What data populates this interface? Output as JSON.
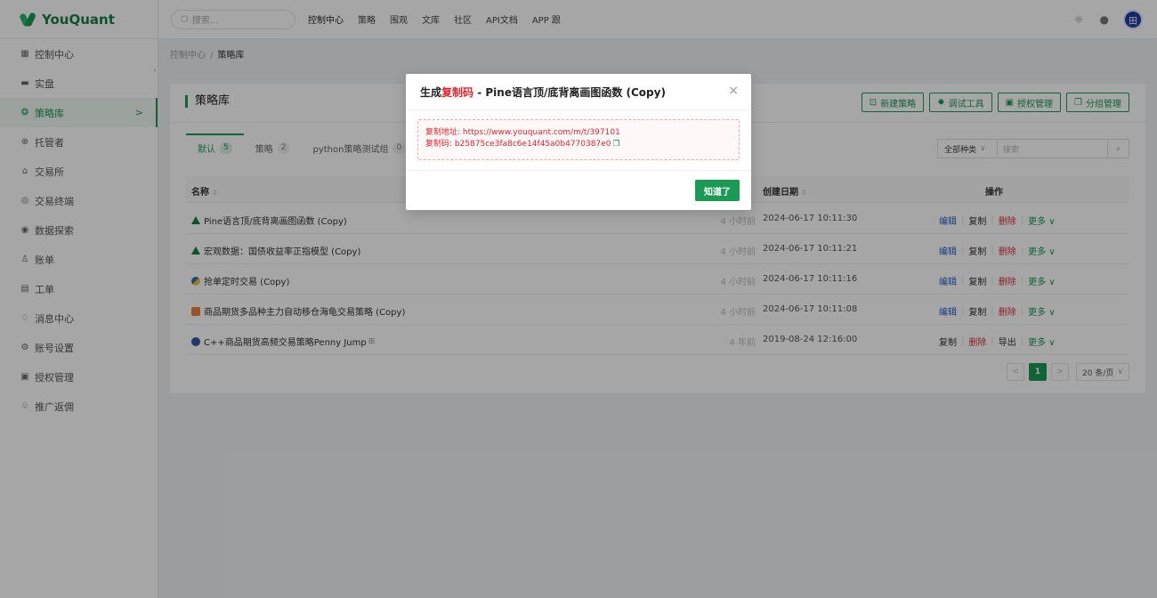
{
  "app": {
    "brand": "YouQuant"
  },
  "sidebar": {
    "items": [
      {
        "label": "控制中心",
        "icon": "dashboard-icon",
        "glyph": "▦"
      },
      {
        "label": "实盘",
        "icon": "live-icon",
        "glyph": "▬"
      },
      {
        "label": "策略库",
        "icon": "strategy-icon",
        "glyph": "❂"
      },
      {
        "label": "托管者",
        "icon": "docker-icon",
        "glyph": "⊕"
      },
      {
        "label": "交易所",
        "icon": "exchange-icon",
        "glyph": "⌂"
      },
      {
        "label": "交易终端",
        "icon": "terminal-icon",
        "glyph": "◎"
      },
      {
        "label": "数据探索",
        "icon": "data-icon",
        "glyph": "◉"
      },
      {
        "label": "账单",
        "icon": "bill-icon",
        "glyph": "♙"
      },
      {
        "label": "工单",
        "icon": "ticket-icon",
        "glyph": "▤"
      },
      {
        "label": "消息中心",
        "icon": "bell-icon",
        "glyph": "♢"
      },
      {
        "label": "账号设置",
        "icon": "gear-icon",
        "glyph": "⚙"
      },
      {
        "label": "授权管理",
        "icon": "auth-icon",
        "glyph": "▣"
      },
      {
        "label": "推广返佣",
        "icon": "promote-icon",
        "glyph": "♧"
      }
    ],
    "active_arrow": ">"
  },
  "topbar": {
    "search_placeholder": "搜索...",
    "nav": [
      "控制中心",
      "策略",
      "围观",
      "文库",
      "社区",
      "API文档",
      "APP 跟"
    ],
    "avatar_text": "田"
  },
  "breadcrumb": {
    "root": "控制中心",
    "sep": "/",
    "current": "策略库"
  },
  "card": {
    "title": "策略库",
    "actions": [
      {
        "label": "新建策略",
        "icon": "new-file-icon",
        "glyph": "⊡"
      },
      {
        "label": "调试工具",
        "icon": "debug-icon",
        "glyph": "✹"
      },
      {
        "label": "授权管理",
        "icon": "auth-icon",
        "glyph": "▣"
      },
      {
        "label": "分组管理",
        "icon": "group-icon",
        "glyph": "❐"
      }
    ],
    "tabs": [
      {
        "label": "默认",
        "count": "5"
      },
      {
        "label": "策略",
        "count": "2"
      },
      {
        "label": "python策略测试组",
        "count": "0"
      }
    ],
    "filter": {
      "type_value": "全部种类",
      "search_placeholder": "搜索"
    }
  },
  "table": {
    "headers": {
      "name": "名称",
      "date": "创建日期",
      "ops": "操作",
      "sort_glyph": "⇕"
    },
    "rows": [
      {
        "lang": "tri",
        "name": "Pine语言顶/底背离画图函数 (Copy)",
        "rel": "4 小时前",
        "date": "2024-06-17 10:11:30"
      },
      {
        "lang": "tri",
        "name": "宏观数据：国债收益率正指模型 (Copy)",
        "rel": "4 小时前",
        "date": "2024-06-17 10:11:21"
      },
      {
        "lang": "py",
        "name": "抢单定时交易 (Copy)",
        "rel": "4 小时前",
        "date": "2024-06-17 10:11:16"
      },
      {
        "lang": "js",
        "name": "商品期货多品种主力自动移仓海龟交易策略 (Copy)",
        "rel": "4 小时前",
        "date": "2024-06-17 10:11:08"
      },
      {
        "lang": "cpp",
        "name": "C++商品期货高频交易策略Penny Jump",
        "rel": "4 年前",
        "date": "2019-08-24 12:16:00"
      }
    ],
    "op_labels": {
      "edit": "编辑",
      "copy": "复制",
      "delete": "删除",
      "more": "更多 ∨",
      "export": "导出"
    }
  },
  "pagination": {
    "prev": "<",
    "page": "1",
    "next": ">",
    "page_size": "20 条/页"
  },
  "modal": {
    "title_prefix": "生成",
    "title_highlight": "复制码",
    "title_suffix": " - Pine语言顶/底背离画图函数 (Copy)",
    "close": "×",
    "address_label": "复制地址: https://www.youquant.com/m/t/397101",
    "code_label": "复制码: b25875ce3fa8c6e14f45a0b4770387e0",
    "ok_button": "知道了"
  },
  "colors": {
    "accent": "#1a9a55",
    "danger": "#e0242e",
    "link": "#1f5cc9"
  }
}
